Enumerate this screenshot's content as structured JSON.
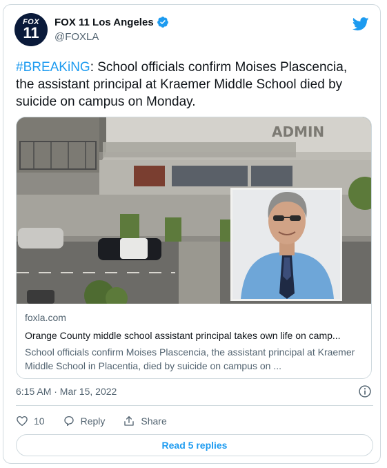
{
  "account": {
    "avatar_line1": "FOX",
    "avatar_line2": "11",
    "name": "FOX 11 Los Angeles",
    "handle": "@FOXLA",
    "verified": true
  },
  "tweet": {
    "hashtag": "#BREAKiNG",
    "text": ": School officials confirm Moises Plascencia, the assistant principal at Kraemer Middle School died by suicide on campus on Monday."
  },
  "link_card": {
    "image_sign_text": "ADMIN",
    "domain": "foxla.com",
    "title": "Orange County middle school assistant principal takes own life on camp...",
    "description": "School officials confirm Moises Plascencia, the assistant principal at Kraemer Middle School in Placentia, died by suicide on campus on ..."
  },
  "meta": {
    "timestamp": "6:15 AM · Mar 15, 2022"
  },
  "actions": {
    "like_count": "10",
    "reply_label": "Reply",
    "share_label": "Share"
  },
  "read_replies_label": "Read 5 replies",
  "icons": [
    "twitter-bird-icon",
    "verified-badge-icon",
    "info-icon",
    "heart-icon",
    "reply-icon",
    "share-icon"
  ],
  "colors": {
    "accent": "#1d9bf0",
    "text": "#0f1419",
    "secondary_text": "#536471",
    "border": "#cfd9de",
    "avatar_bg": "#0a1a3a"
  }
}
